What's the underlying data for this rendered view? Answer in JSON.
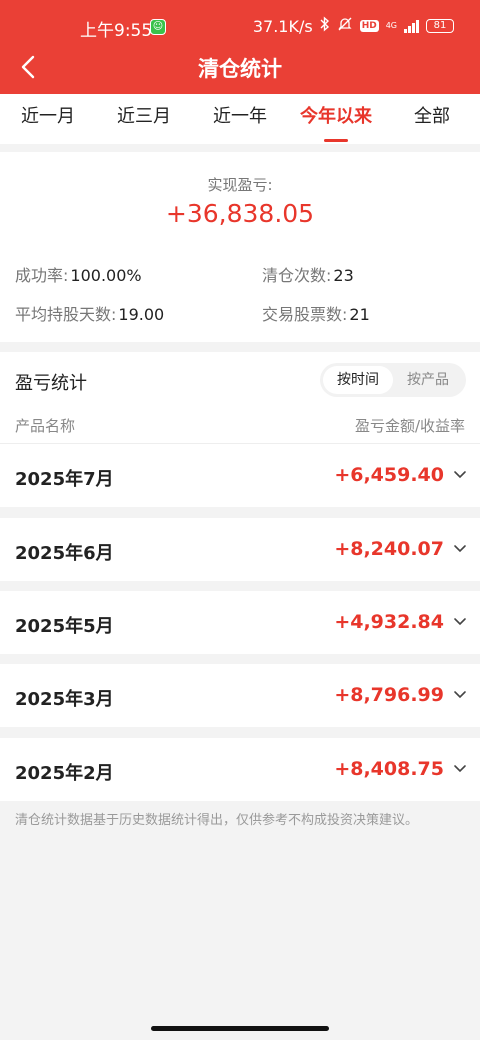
{
  "status_bar": {
    "time": "上午9:55",
    "app_dot": "☺",
    "net_speed": "37.1K/s",
    "hd": "HD",
    "network": "4G",
    "battery": "81"
  },
  "header": {
    "title": "清仓统计",
    "back_icon": "chevron-left-icon"
  },
  "tabs": [
    {
      "label": "近一月",
      "active": false
    },
    {
      "label": "近三月",
      "active": false
    },
    {
      "label": "近一年",
      "active": false
    },
    {
      "label": "今年以来",
      "active": true
    },
    {
      "label": "全部",
      "active": false
    }
  ],
  "summary": {
    "label": "实现盈亏:",
    "value": "+36,838.05",
    "success_rate_label": "成功率:",
    "success_rate": "100.00%",
    "clear_count_label": "清仓次数:",
    "clear_count": "23",
    "avg_days_label": "平均持股天数:",
    "avg_days": "19.00",
    "stock_count_label": "交易股票数:",
    "stock_count": "21"
  },
  "pl": {
    "title": "盈亏统计",
    "by_time": "按时间",
    "by_product": "按产品",
    "col_name": "产品名称",
    "col_value": "盈亏金额/收益率"
  },
  "rows": [
    {
      "label": "2025年7月",
      "value": "+6,459.40"
    },
    {
      "label": "2025年6月",
      "value": "+8,240.07"
    },
    {
      "label": "2025年5月",
      "value": "+4,932.84"
    },
    {
      "label": "2025年3月",
      "value": "+8,796.99"
    },
    {
      "label": "2025年2月",
      "value": "+8,408.75"
    }
  ],
  "footnote": "清仓统计数据基于历史数据统计得出，仅供参考不构成投资决策建议。",
  "colors": {
    "brand": "#ea4036",
    "profit": "#e8362b"
  }
}
